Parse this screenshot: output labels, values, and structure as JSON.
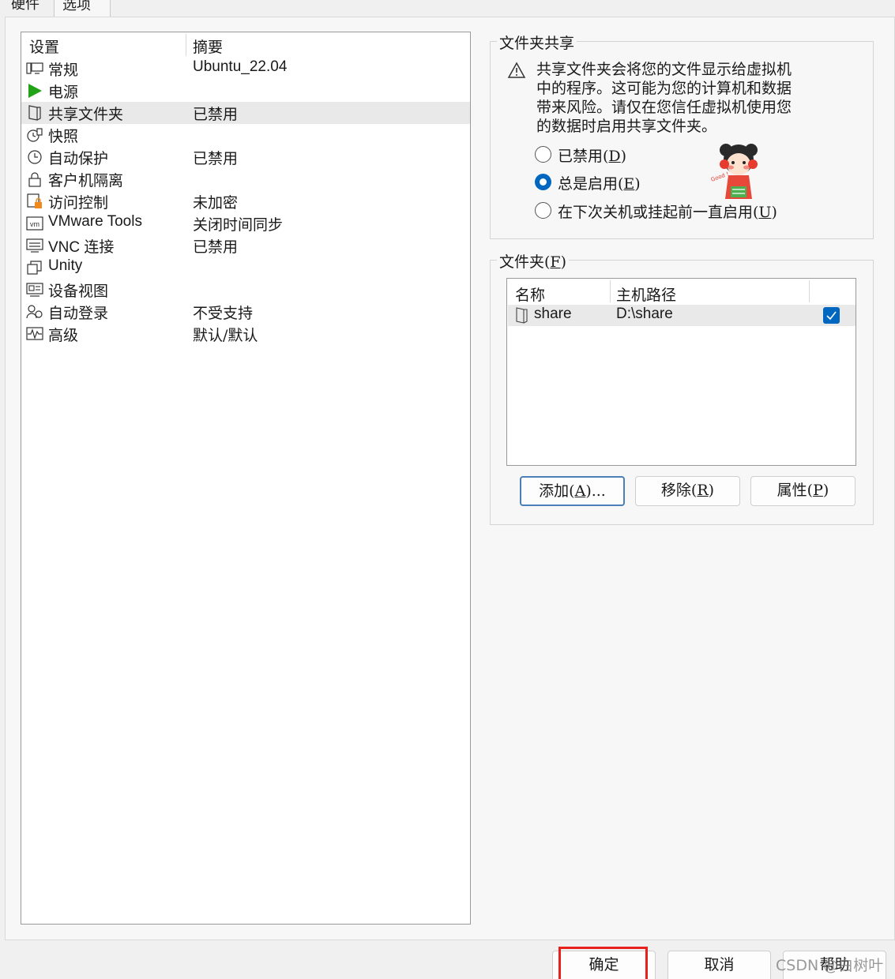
{
  "tabs": {
    "hardware": "硬件",
    "options": "选项"
  },
  "settings": {
    "col_setting": "设置",
    "col_summary": "摘要",
    "rows": [
      {
        "icon": "monitor-icon",
        "label": "常规",
        "summary": "Ubuntu_22.04"
      },
      {
        "icon": "power-play-icon",
        "label": "电源",
        "summary": ""
      },
      {
        "icon": "shared-folder-icon",
        "label": "共享文件夹",
        "summary": "已禁用"
      },
      {
        "icon": "snapshot-icon",
        "label": "快照",
        "summary": ""
      },
      {
        "icon": "clock-icon",
        "label": "自动保护",
        "summary": "已禁用"
      },
      {
        "icon": "lock-icon",
        "label": "客户机隔离",
        "summary": ""
      },
      {
        "icon": "access-control-icon",
        "label": "访问控制",
        "summary": "未加密"
      },
      {
        "icon": "vmware-tools-icon",
        "label": "VMware Tools",
        "summary": "关闭时间同步"
      },
      {
        "icon": "vnc-icon",
        "label": "VNC 连接",
        "summary": "已禁用"
      },
      {
        "icon": "unity-icon",
        "label": "Unity",
        "summary": ""
      },
      {
        "icon": "device-view-icon",
        "label": "设备视图",
        "summary": ""
      },
      {
        "icon": "autologin-icon",
        "label": "自动登录",
        "summary": "不受支持"
      },
      {
        "icon": "advanced-icon",
        "label": "高级",
        "summary": "默认/默认"
      }
    ]
  },
  "folder_sharing": {
    "title": "文件夹共享",
    "warning": "共享文件夹会将您的文件显示给虚拟机中的程序。这可能为您的计算机和数据带来风险。请仅在您信任虚拟机使用您的数据时启用共享文件夹。",
    "options": [
      {
        "label": "已禁用(",
        "key": "D",
        "label_end": ")",
        "selected": false
      },
      {
        "label": "总是启用(",
        "key": "E",
        "label_end": ")",
        "selected": true
      },
      {
        "label": "在下次关机或挂起前一直启用(",
        "key": "U",
        "label_end": ")",
        "selected": false
      }
    ]
  },
  "folders": {
    "title": "文件夹(",
    "title_key": "F",
    "title_end": ")",
    "col_name": "名称",
    "col_path": "主机路径",
    "rows": [
      {
        "name": "share",
        "path": "D:\\share",
        "enabled": true
      }
    ],
    "buttons": {
      "add": {
        "label": "添加(",
        "key": "A",
        "end": ")..."
      },
      "remove": {
        "label": "移除(",
        "key": "R",
        "end": ")"
      },
      "properties": {
        "label": "属性(",
        "key": "P",
        "end": ")"
      }
    }
  },
  "dialog_buttons": {
    "ok": "确定",
    "cancel": "取消",
    "help": "帮助"
  },
  "watermark": "CSDN @白树叶",
  "colors": {
    "accent": "#0067c0",
    "highlight_box": "#e8211d",
    "play_green": "#22a317"
  }
}
